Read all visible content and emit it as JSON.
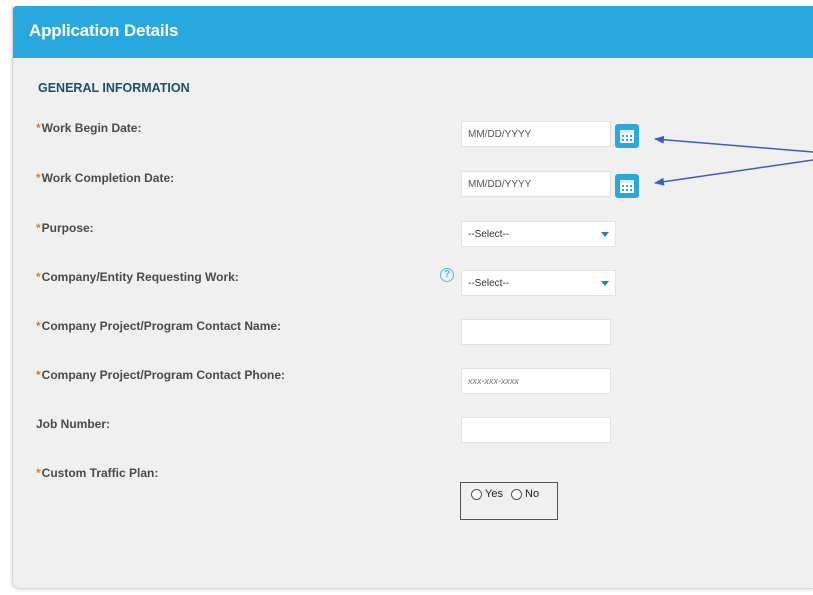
{
  "header": {
    "title": "Application Details"
  },
  "section": {
    "title": "GENERAL INFORMATION"
  },
  "required_marker": "*",
  "fields": {
    "work_begin_date": {
      "label": "Work Begin Date:",
      "placeholder": "MM/DD/YYYY",
      "required": true
    },
    "work_completion_date": {
      "label": "Work Completion Date:",
      "placeholder": "MM/DD/YYYY",
      "required": true
    },
    "purpose": {
      "label": "Purpose:",
      "selected": "--Select--",
      "required": true
    },
    "company_entity": {
      "label": "Company/Entity Requesting Work:",
      "selected": "--Select--",
      "required": true
    },
    "contact_name": {
      "label": "Company Project/Program Contact Name:",
      "value": "",
      "required": true
    },
    "contact_phone": {
      "label": "Company Project/Program Contact Phone:",
      "placeholder": "xxx-xxx-xxxx",
      "required": true
    },
    "job_number": {
      "label": "Job Number:",
      "value": "",
      "required": false
    },
    "custom_traffic_plan": {
      "label": "Custom Traffic Plan:",
      "options": [
        "Yes",
        "No"
      ],
      "required": true
    }
  },
  "icons": {
    "calendar": "calendar-icon",
    "help": "question-mark-icon",
    "dropdown": "chevron-down-icon",
    "help_glyph": "?"
  },
  "colors": {
    "header_bg": "#29a7df",
    "required": "#e07b1a",
    "section_title": "#1b4f72",
    "annotation_arrow": "#3a5fc0"
  }
}
